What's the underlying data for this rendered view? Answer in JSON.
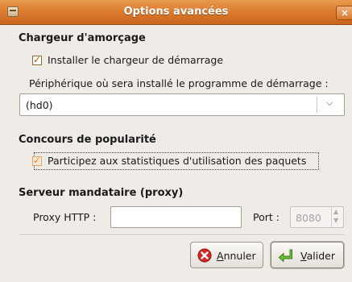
{
  "window": {
    "title": "Options avancées"
  },
  "bootloader": {
    "section_title": "Chargeur d'amorçage",
    "install_label": "Installer le chargeur de démarrage",
    "install_checked": true,
    "device_label": "Périphérique où sera installé le programme de démarrage :",
    "device_value": "(hd0)"
  },
  "popularity": {
    "section_title": "Concours de popularité",
    "participate_label": "Participez aux statistiques d'utilisation des paquets",
    "participate_checked": true
  },
  "proxy": {
    "section_title": "Serveur mandataire (proxy)",
    "http_label": "Proxy HTTP :",
    "http_value": "",
    "port_label": "Port :",
    "port_value": "8080"
  },
  "buttons": {
    "cancel_first": "A",
    "cancel_rest": "nnuler",
    "ok_first": "V",
    "ok_rest": "alider"
  }
}
